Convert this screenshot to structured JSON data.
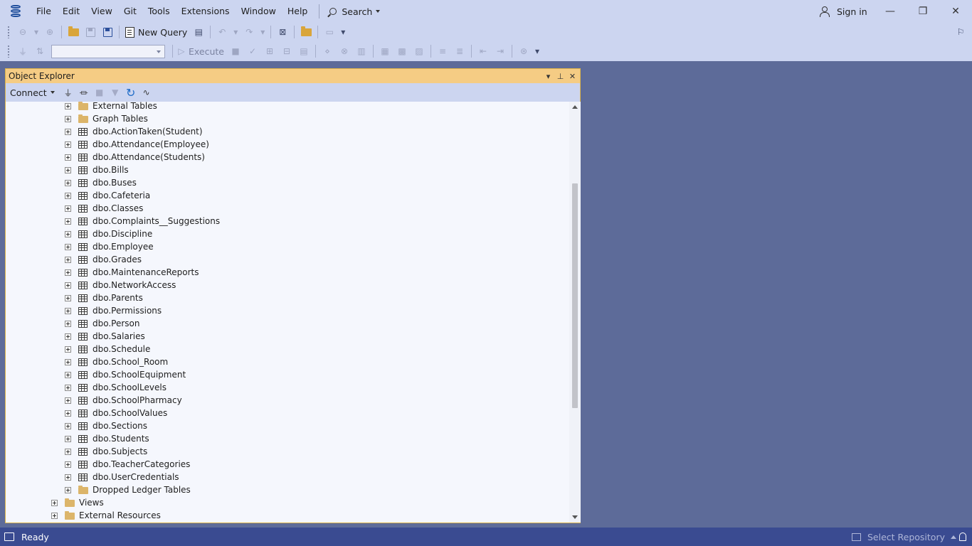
{
  "menu": [
    "File",
    "Edit",
    "View",
    "Git",
    "Tools",
    "Extensions",
    "Window",
    "Help"
  ],
  "search_label": "Search",
  "signin_label": "Sign in",
  "window_controls": {
    "minimize": "—",
    "restore": "❐",
    "close": "✕"
  },
  "toolbar": {
    "new_query_label": "New Query",
    "execute_label": "Execute",
    "database_combo_value": ""
  },
  "object_explorer": {
    "title": "Object Explorer",
    "connect_label": "Connect",
    "header_buttons": {
      "dropdown": "▾",
      "pin": "⊥",
      "close": "✕"
    },
    "tree": [
      {
        "label": "External Tables",
        "icon": "folder-icon",
        "level": 2
      },
      {
        "label": "Graph Tables",
        "icon": "folder-icon",
        "level": 2
      },
      {
        "label": "dbo.ActionTaken(Student)",
        "icon": "table-icon",
        "level": 2
      },
      {
        "label": "dbo.Attendance(Employee)",
        "icon": "table-icon",
        "level": 2
      },
      {
        "label": "dbo.Attendance(Students)",
        "icon": "table-icon",
        "level": 2
      },
      {
        "label": "dbo.Bills",
        "icon": "table-icon",
        "level": 2
      },
      {
        "label": "dbo.Buses",
        "icon": "table-icon",
        "level": 2
      },
      {
        "label": "dbo.Cafeteria",
        "icon": "table-icon",
        "level": 2
      },
      {
        "label": "dbo.Classes",
        "icon": "table-icon",
        "level": 2
      },
      {
        "label": "dbo.Complaints__Suggestions",
        "icon": "table-icon",
        "level": 2
      },
      {
        "label": "dbo.Discipline",
        "icon": "table-icon",
        "level": 2
      },
      {
        "label": "dbo.Employee",
        "icon": "table-icon",
        "level": 2
      },
      {
        "label": "dbo.Grades",
        "icon": "table-icon",
        "level": 2
      },
      {
        "label": "dbo.MaintenanceReports",
        "icon": "table-icon",
        "level": 2
      },
      {
        "label": "dbo.NetworkAccess",
        "icon": "table-icon",
        "level": 2
      },
      {
        "label": "dbo.Parents",
        "icon": "table-icon",
        "level": 2
      },
      {
        "label": "dbo.Permissions",
        "icon": "table-icon",
        "level": 2
      },
      {
        "label": "dbo.Person",
        "icon": "table-icon",
        "level": 2
      },
      {
        "label": "dbo.Salaries",
        "icon": "table-icon",
        "level": 2
      },
      {
        "label": "dbo.Schedule",
        "icon": "table-icon",
        "level": 2
      },
      {
        "label": "dbo.School_Room",
        "icon": "table-icon",
        "level": 2
      },
      {
        "label": "dbo.SchoolEquipment",
        "icon": "table-icon",
        "level": 2
      },
      {
        "label": "dbo.SchoolLevels",
        "icon": "table-icon",
        "level": 2
      },
      {
        "label": "dbo.SchoolPharmacy",
        "icon": "table-icon",
        "level": 2
      },
      {
        "label": "dbo.SchoolValues",
        "icon": "table-icon",
        "level": 2
      },
      {
        "label": "dbo.Sections",
        "icon": "table-icon",
        "level": 2
      },
      {
        "label": "dbo.Students",
        "icon": "table-icon",
        "level": 2
      },
      {
        "label": "dbo.Subjects",
        "icon": "table-icon",
        "level": 2
      },
      {
        "label": "dbo.TeacherCategories",
        "icon": "table-icon",
        "level": 2
      },
      {
        "label": "dbo.UserCredentials",
        "icon": "table-icon",
        "level": 2
      },
      {
        "label": "Dropped Ledger Tables",
        "icon": "folder-icon",
        "level": 2
      },
      {
        "label": "Views",
        "icon": "folder-icon",
        "level": 1
      },
      {
        "label": "External Resources",
        "icon": "folder-icon",
        "level": 1
      }
    ]
  },
  "statusbar": {
    "status_text": "Ready",
    "repository_label": "Select Repository"
  },
  "colors": {
    "workspace": "#5d6b99",
    "chrome": "#ccd5f0",
    "panel_header": "#f5cc84",
    "statusbar": "#3a4b91"
  }
}
